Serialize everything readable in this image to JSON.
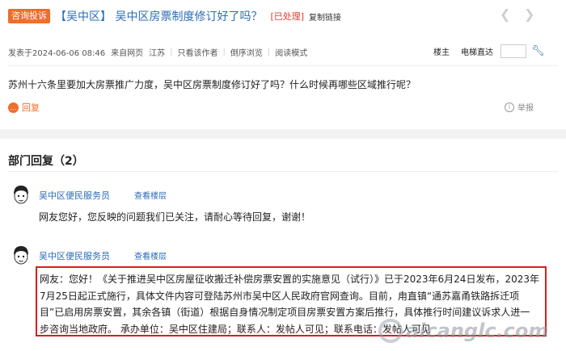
{
  "post": {
    "tag": "咨询投诉",
    "title": "【吴中区】 吴中区房票制度修订好了吗？",
    "status": "[已处理]",
    "copy_link": "复制链接",
    "meta": {
      "posted_at": "发表于2024-06-06 08:46",
      "source": "来自网页",
      "region": "江苏",
      "author_only": "只看该作者",
      "reverse_view": "倒序浏览",
      "read_mode": "阅读模式"
    },
    "owner_label": "楼主",
    "jump_label": "电梯直达",
    "body": "苏州十六条里要加大房票推广力度，吴中区房票制度修订好了吗？什么时候再哪些区域推行呢？",
    "reply_label": "回复",
    "report_label": "举报",
    "icons": {
      "prev": "chevron-left-icon",
      "next": "chevron-right-icon",
      "jump": "wrench-jump-icon",
      "reply": "reply-bubble-icon",
      "report": "info-icon"
    }
  },
  "replies_section": {
    "title": "部门回复（2）",
    "replies": [
      {
        "author": "吴中区便民服务员",
        "view_floor": "查看楼层",
        "text": "网友您好，您反映的问题我们已关注，请耐心等待回复，谢谢！"
      },
      {
        "author": "吴中区便民服务员",
        "view_floor": "查看楼层",
        "lines": [
          "网友：您好！《关于推进吴中区房屋征收搬迁补偿房票安置的实施意见（试行）》已于2023年6月24日发布，2023年",
          "7月25日起正式施行，具体文件内容可登陆苏州市吴中区人民政府官网查询。目前，甪直镇“通苏嘉甬铁路拆迁项",
          "目”已启用房票安置，其余各镇（街道）根据自身情况制定项目房票安置方案后推行，具体推行时间建议诉求人进一",
          "步咨询当地政府。 承办单位：吴中区住建局；联系人：发帖人可见；联系电话：发帖人可见"
        ]
      }
    ]
  },
  "watermark": "aicanglc.com",
  "colors": {
    "accent": "#f06d2b",
    "link": "#2a6bb7",
    "status": "#e03b2c",
    "highlight_border": "#d81e1e"
  }
}
